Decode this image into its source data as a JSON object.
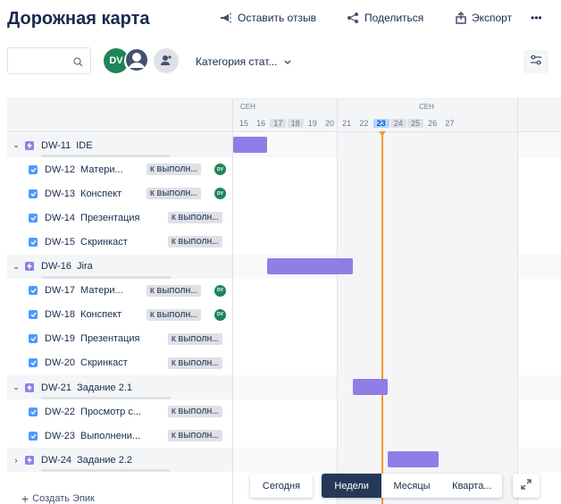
{
  "header": {
    "title": "Дорожная карта",
    "feedback_label": "Оставить отзыв",
    "share_label": "Поделиться",
    "export_label": "Экспорт",
    "more_label": "•••"
  },
  "filters": {
    "search_placeholder": "",
    "avatar_initials": "DV",
    "category_label": "Категория стат..."
  },
  "timeline": {
    "months": [
      "СЕН",
      "СЕН"
    ],
    "days": [
      "15",
      "16",
      "17",
      "18",
      "19",
      "20",
      "21",
      "22",
      "23",
      "24",
      "25",
      "26",
      "27"
    ],
    "today": "23",
    "accent": "#f79233",
    "bar_color": "#8f7ee7"
  },
  "rows": [
    {
      "type": "epic",
      "expanded": true,
      "key": "DW-11",
      "summary": "IDE",
      "bar": {
        "start_day": "15",
        "end_day": "17"
      }
    },
    {
      "type": "task",
      "key": "DW-12",
      "summary": "Матери...",
      "status": "К ВЫПОЛН...",
      "assignee": "DV"
    },
    {
      "type": "task",
      "key": "DW-13",
      "summary": "Конспект",
      "status": "К ВЫПОЛН...",
      "assignee": "DV"
    },
    {
      "type": "task",
      "key": "DW-14",
      "summary": "Презентация",
      "status": "К ВЫПОЛН..."
    },
    {
      "type": "task",
      "key": "DW-15",
      "summary": "Скринкаст",
      "status": "К ВЫПОЛН..."
    },
    {
      "type": "epic",
      "expanded": true,
      "key": "DW-16",
      "summary": "Jira",
      "bar": {
        "start_day": "17",
        "end_day": "22"
      }
    },
    {
      "type": "task",
      "key": "DW-17",
      "summary": "Матери...",
      "status": "К ВЫПОЛН...",
      "assignee": "DV"
    },
    {
      "type": "task",
      "key": "DW-18",
      "summary": "Конспект",
      "status": "К ВЫПОЛН...",
      "assignee": "DV"
    },
    {
      "type": "task",
      "key": "DW-19",
      "summary": "Презентация",
      "status": "К ВЫПОЛН..."
    },
    {
      "type": "task",
      "key": "DW-20",
      "summary": "Скринкаст",
      "status": "К ВЫПОЛН..."
    },
    {
      "type": "epic",
      "expanded": true,
      "key": "DW-21",
      "summary": "Задание 2.1",
      "bar": {
        "start_day": "22",
        "end_day": "24"
      }
    },
    {
      "type": "task",
      "key": "DW-22",
      "summary": "Просмотр с...",
      "status": "К ВЫПОЛН..."
    },
    {
      "type": "task",
      "key": "DW-23",
      "summary": "Выполнени...",
      "status": "К ВЫПОЛН..."
    },
    {
      "type": "epic",
      "expanded": false,
      "key": "DW-24",
      "summary": "Задание 2.2",
      "bar": {
        "start_day": "24",
        "end_day": "27"
      }
    }
  ],
  "create_epic_label": "Создать Эпик",
  "controls": {
    "today_label": "Сегодня",
    "weeks_label": "Недели",
    "months_label": "Месяцы",
    "quarters_label": "Кварта..."
  }
}
